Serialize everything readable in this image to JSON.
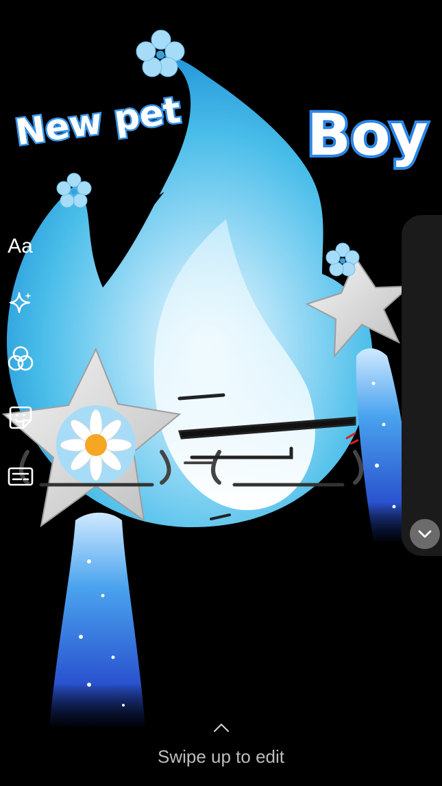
{
  "canvas": {
    "stickers": {
      "new_pet_text": "New pet",
      "boy_text": "Boy",
      "face_kaomoji": "(___)=(___)"
    },
    "colors": {
      "background": "#000000",
      "flame_light": "#d8f3fc",
      "flame_mid": "#49bde9",
      "flame_dark": "#1f8fd6",
      "jet_blue": "#2b5fd8",
      "star_silver": "#d9d9d9",
      "flower_blue": "#a6dcf7",
      "sticker_outline": "#2f8ff0"
    }
  },
  "tools": {
    "text_label": "Aa",
    "items": [
      {
        "name": "text",
        "icon": "text-aa-icon"
      },
      {
        "name": "effects",
        "icon": "sparkle-icon"
      },
      {
        "name": "filters",
        "icon": "filter-circles-icon"
      },
      {
        "name": "stickers",
        "icon": "sticker-smile-icon"
      },
      {
        "name": "captions",
        "icon": "caption-box-icon"
      },
      {
        "name": "more",
        "icon": "chevron-down-icon"
      }
    ]
  },
  "footer": {
    "chevron_icon": "chevron-up-icon",
    "swipe_label": "Swipe up to edit"
  }
}
